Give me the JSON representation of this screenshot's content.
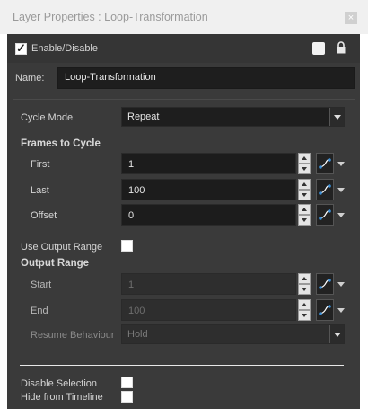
{
  "window": {
    "title": "Layer Properties : Loop-Transformation",
    "close_glyph": "×"
  },
  "header": {
    "enable_label": "Enable/Disable",
    "enable_checked": true
  },
  "name": {
    "label": "Name:",
    "value": "Loop-Transformation"
  },
  "cycle_mode": {
    "label": "Cycle Mode",
    "value": "Repeat"
  },
  "frames_to_cycle": {
    "heading": "Frames to Cycle",
    "first": {
      "label": "First",
      "value": "1"
    },
    "last": {
      "label": "Last",
      "value": "100"
    },
    "offset": {
      "label": "Offset",
      "value": "0"
    }
  },
  "use_output_range": {
    "label": "Use Output Range",
    "checked": false
  },
  "output_range": {
    "heading": "Output Range",
    "start": {
      "label": "Start",
      "value": "1"
    },
    "end": {
      "label": "End",
      "value": "100"
    },
    "resume_behaviour": {
      "label": "Resume Behaviour",
      "value": "Hold"
    }
  },
  "footer": {
    "disable_selection": {
      "label": "Disable Selection",
      "checked": false
    },
    "hide_from_timeline": {
      "label": "Hide from Timeline",
      "checked": false
    }
  },
  "icons": {
    "close": "close-icon",
    "lock": "lock-icon",
    "color_swatch": "color-swatch-icon",
    "function_curve": "function-curve-icon",
    "dropdown": "chevron-down-icon",
    "spin_up": "spin-up-icon",
    "spin_down": "spin-down-icon"
  },
  "colors": {
    "panel_bg": "#3a3a3a",
    "field_bg": "#1e1e1e",
    "curve_accent": "#3a8fd8"
  }
}
